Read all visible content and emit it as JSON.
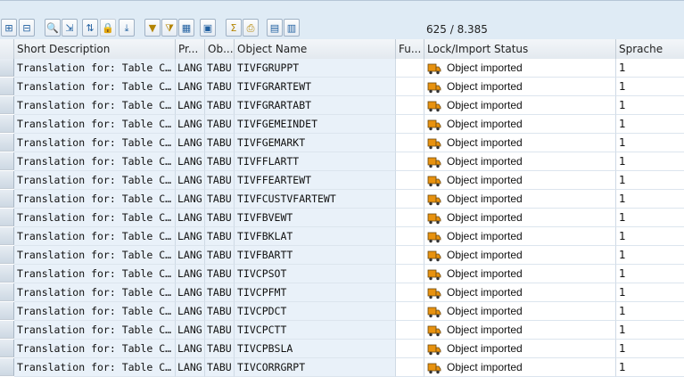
{
  "toolbar": {
    "buttons": [
      {
        "name": "select-all-icon",
        "glyph": "⊞"
      },
      {
        "name": "deselect-all-icon",
        "glyph": "⊟"
      },
      {
        "name": "find-icon",
        "glyph": "🔍"
      },
      {
        "name": "expand-icon",
        "glyph": "⇲"
      },
      {
        "name": "hierarchy-icon",
        "glyph": "⇅"
      },
      {
        "name": "lock-icon",
        "glyph": "🔒"
      },
      {
        "name": "download-icon",
        "glyph": "⤓"
      },
      {
        "name": "filter-icon",
        "glyph": "▼"
      },
      {
        "name": "filter-settings-icon",
        "glyph": "⧩"
      },
      {
        "name": "display-icon",
        "glyph": "▦"
      },
      {
        "name": "details-icon",
        "glyph": "▣"
      },
      {
        "name": "sum-icon",
        "glyph": "Σ"
      },
      {
        "name": "print-icon",
        "glyph": "⎙"
      },
      {
        "name": "export-icon",
        "glyph": "▤"
      },
      {
        "name": "layout-icon",
        "glyph": "▥"
      }
    ],
    "counter": "625 / 8.385"
  },
  "table": {
    "headers": [
      "Short Description",
      "Pr...",
      "Ob...",
      "Object Name",
      "Fu...",
      "Lock/Import Status",
      "Sprache"
    ],
    "rows": [
      {
        "desc": "Translation for: Table C…",
        "pr": "LANG",
        "ob": "TABU",
        "name": "TIVFGRUPPT",
        "status": "Object imported",
        "lang": "1"
      },
      {
        "desc": "Translation for: Table C…",
        "pr": "LANG",
        "ob": "TABU",
        "name": "TIVFGRARTEWT",
        "status": "Object imported",
        "lang": "1"
      },
      {
        "desc": "Translation for: Table C…",
        "pr": "LANG",
        "ob": "TABU",
        "name": "TIVFGRARTABT",
        "status": "Object imported",
        "lang": "1"
      },
      {
        "desc": "Translation for: Table C…",
        "pr": "LANG",
        "ob": "TABU",
        "name": "TIVFGEMEINDET",
        "status": "Object imported",
        "lang": "1"
      },
      {
        "desc": "Translation for: Table C…",
        "pr": "LANG",
        "ob": "TABU",
        "name": "TIVFGEMARKT",
        "status": "Object imported",
        "lang": "1"
      },
      {
        "desc": "Translation for: Table C…",
        "pr": "LANG",
        "ob": "TABU",
        "name": "TIVFFLARTT",
        "status": "Object imported",
        "lang": "1"
      },
      {
        "desc": "Translation for: Table C…",
        "pr": "LANG",
        "ob": "TABU",
        "name": "TIVFFEARTEWT",
        "status": "Object imported",
        "lang": "1"
      },
      {
        "desc": "Translation for: Table C…",
        "pr": "LANG",
        "ob": "TABU",
        "name": "TIVFCUSTVFARTEWT",
        "status": "Object imported",
        "lang": "1"
      },
      {
        "desc": "Translation for: Table C…",
        "pr": "LANG",
        "ob": "TABU",
        "name": "TIVFBVEWT",
        "status": "Object imported",
        "lang": "1"
      },
      {
        "desc": "Translation for: Table C…",
        "pr": "LANG",
        "ob": "TABU",
        "name": "TIVFBKLAT",
        "status": "Object imported",
        "lang": "1"
      },
      {
        "desc": "Translation for: Table C…",
        "pr": "LANG",
        "ob": "TABU",
        "name": "TIVFBARTT",
        "status": "Object imported",
        "lang": "1"
      },
      {
        "desc": "Translation for: Table C…",
        "pr": "LANG",
        "ob": "TABU",
        "name": "TIVCPSOT",
        "status": "Object imported",
        "lang": "1"
      },
      {
        "desc": "Translation for: Table C…",
        "pr": "LANG",
        "ob": "TABU",
        "name": "TIVCPFMT",
        "status": "Object imported",
        "lang": "1"
      },
      {
        "desc": "Translation for: Table C…",
        "pr": "LANG",
        "ob": "TABU",
        "name": "TIVCPDCT",
        "status": "Object imported",
        "lang": "1"
      },
      {
        "desc": "Translation for: Table C…",
        "pr": "LANG",
        "ob": "TABU",
        "name": "TIVCPCTT",
        "status": "Object imported",
        "lang": "1"
      },
      {
        "desc": "Translation for: Table C…",
        "pr": "LANG",
        "ob": "TABU",
        "name": "TIVCPBSLA",
        "status": "Object imported",
        "lang": "1"
      },
      {
        "desc": "Translation for: Table C…",
        "pr": "LANG",
        "ob": "TABU",
        "name": "TIVCORRGRPT",
        "status": "Object imported",
        "lang": "1"
      }
    ]
  },
  "colors": {
    "truck_orange": "#e8920f",
    "truck_dark": "#6b4a12",
    "cell_bg": "#e9f1f9",
    "toolbar_bg": "#dfebf5"
  }
}
